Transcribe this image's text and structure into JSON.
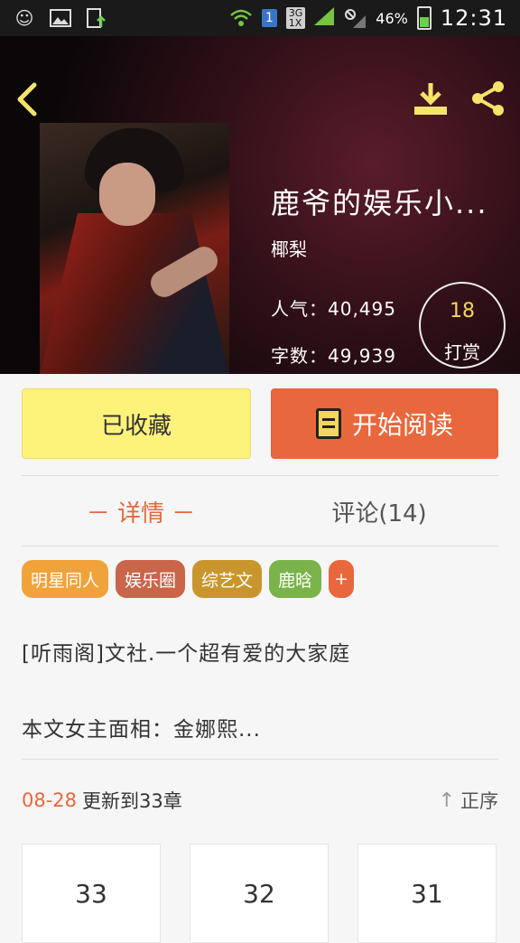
{
  "status_bar": {
    "left_icons": [
      "emoji-icon",
      "image-icon",
      "file-upload-icon"
    ],
    "sim": "1",
    "network_top": "3G",
    "network_bottom": "1X",
    "battery": "46%",
    "time": "12:31"
  },
  "hero": {
    "title": "鹿爷的娱乐小...",
    "author": "椰梨",
    "popularity_label": "人气：",
    "popularity_value": "40,495",
    "words_label": "字数：",
    "words_value": "49,939",
    "reward_count": "18",
    "reward_label": "打赏"
  },
  "actions": {
    "favorite_label": "已收藏",
    "read_label": "开始阅读"
  },
  "tabs": {
    "detail": "－ 详情 －",
    "comments": "评论(14)"
  },
  "tags": [
    {
      "label": "明星同人",
      "color": "#f0a33a"
    },
    {
      "label": "娱乐圈",
      "color": "#c9664a"
    },
    {
      "label": "综艺文",
      "color": "#c9962e"
    },
    {
      "label": "鹿晗",
      "color": "#7ab34a"
    },
    {
      "label": "+",
      "color": "#e8673c"
    }
  ],
  "description": {
    "line1": "[听雨阁]文社.一个超有爱的大家庭",
    "line2": "本文女主面相：金娜熙..."
  },
  "updates": {
    "date": "08-28",
    "text": "更新到33章",
    "sort_label": "正序"
  },
  "chapters": [
    "33",
    "32",
    "31"
  ],
  "colors": {
    "accent": "#e8673c",
    "favorite_bg": "#fef37a",
    "reward_count": "#f5d65a"
  }
}
